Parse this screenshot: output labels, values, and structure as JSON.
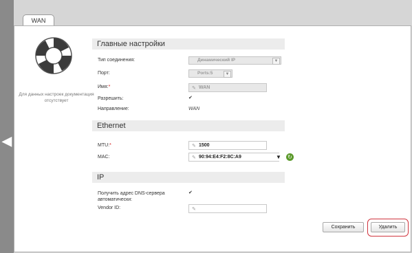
{
  "tab": {
    "label": "WAN"
  },
  "help": {
    "text": "Для данных настроек документация отсутствует"
  },
  "sections": {
    "main": "Главные настройки",
    "ethernet": "Ethernet",
    "ip": "IP"
  },
  "main": {
    "connection_type": {
      "label": "Тип соединения:",
      "value": "Динамический IP"
    },
    "port": {
      "label": "Порт:",
      "value": "Ports:5"
    },
    "name": {
      "label": "Имя:",
      "required_mark": "*",
      "value": "WAN"
    },
    "enable": {
      "label": "Разрешить:",
      "checked": true
    },
    "direction": {
      "label": "Направление:",
      "value": "WAN"
    }
  },
  "ethernet": {
    "mtu": {
      "label": "MTU:",
      "required_mark": "*",
      "value": "1500"
    },
    "mac": {
      "label": "MAC:",
      "value": "90:94:E4:F2:8C:A9"
    }
  },
  "ip": {
    "dns_auto": {
      "label": "Получить адрес DNS-сервера автоматически:",
      "checked": true
    },
    "vendor_id": {
      "label": "Vendor ID:",
      "value": ""
    }
  },
  "buttons": {
    "save": "Сохранить",
    "delete": "Удалить"
  },
  "icons": {
    "nav": "chevron-left-icon",
    "help": "lifebuoy-icon",
    "pencil": "pencil-icon",
    "dropdown": "chevron-down-icon",
    "refresh": "refresh-icon"
  },
  "colors": {
    "accent_highlight": "#d0333d",
    "refresh_icon": "#5c9a2c"
  }
}
